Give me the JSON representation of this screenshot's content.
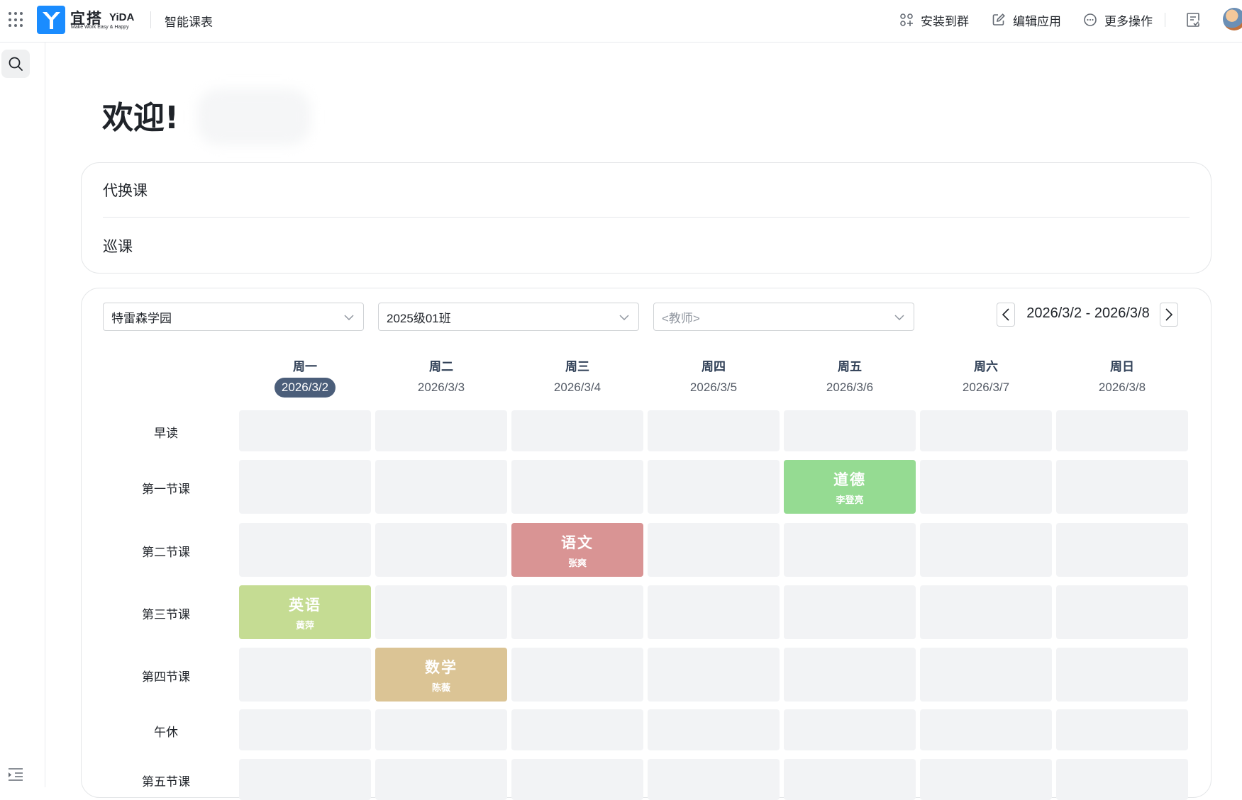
{
  "topbar": {
    "logo_cn": "宜搭",
    "logo_en": "YiDA",
    "logo_slogan": "Make Work Easy & Happy",
    "app_title": "智能课表",
    "actions": {
      "install": "安装到群",
      "edit": "编辑应用",
      "more": "更多操作"
    },
    "brand_color": "#1a8cff"
  },
  "welcome": {
    "text": "欢迎!"
  },
  "links": [
    {
      "label": "代换课"
    },
    {
      "label": "巡课"
    }
  ],
  "filters": {
    "school": {
      "value": "特雷森学园"
    },
    "class": {
      "value": "2025级01班"
    },
    "teacher": {
      "placeholder": "<教师>"
    }
  },
  "week": {
    "range": "2026/3/2 - 2026/3/8",
    "days": [
      {
        "name": "周一",
        "date": "2026/3/2",
        "today": true
      },
      {
        "name": "周二",
        "date": "2026/3/3"
      },
      {
        "name": "周三",
        "date": "2026/3/4"
      },
      {
        "name": "周四",
        "date": "2026/3/5"
      },
      {
        "name": "周五",
        "date": "2026/3/6"
      },
      {
        "name": "周六",
        "date": "2026/3/7"
      },
      {
        "name": "周日",
        "date": "2026/3/8"
      }
    ]
  },
  "periods": [
    {
      "label": "早读"
    },
    {
      "label": "第一节课"
    },
    {
      "label": "第二节课"
    },
    {
      "label": "第三节课"
    },
    {
      "label": "第四节课"
    },
    {
      "label": "午休"
    },
    {
      "label": "第五节课"
    }
  ],
  "lessons": [
    {
      "period": 1,
      "day": 4,
      "subject": "道德",
      "teacher": "李登亮",
      "color": "#95db92"
    },
    {
      "period": 2,
      "day": 2,
      "subject": "语文",
      "teacher": "张爽",
      "color": "#d99494"
    },
    {
      "period": 3,
      "day": 0,
      "subject": "英语",
      "teacher": "黄萍",
      "color": "#c5dc93"
    },
    {
      "period": 4,
      "day": 1,
      "subject": "数学",
      "teacher": "陈薇",
      "color": "#dbc495"
    }
  ],
  "colors": {
    "empty_cell": "#f2f3f5",
    "today_badge": "#4b5e7a"
  }
}
